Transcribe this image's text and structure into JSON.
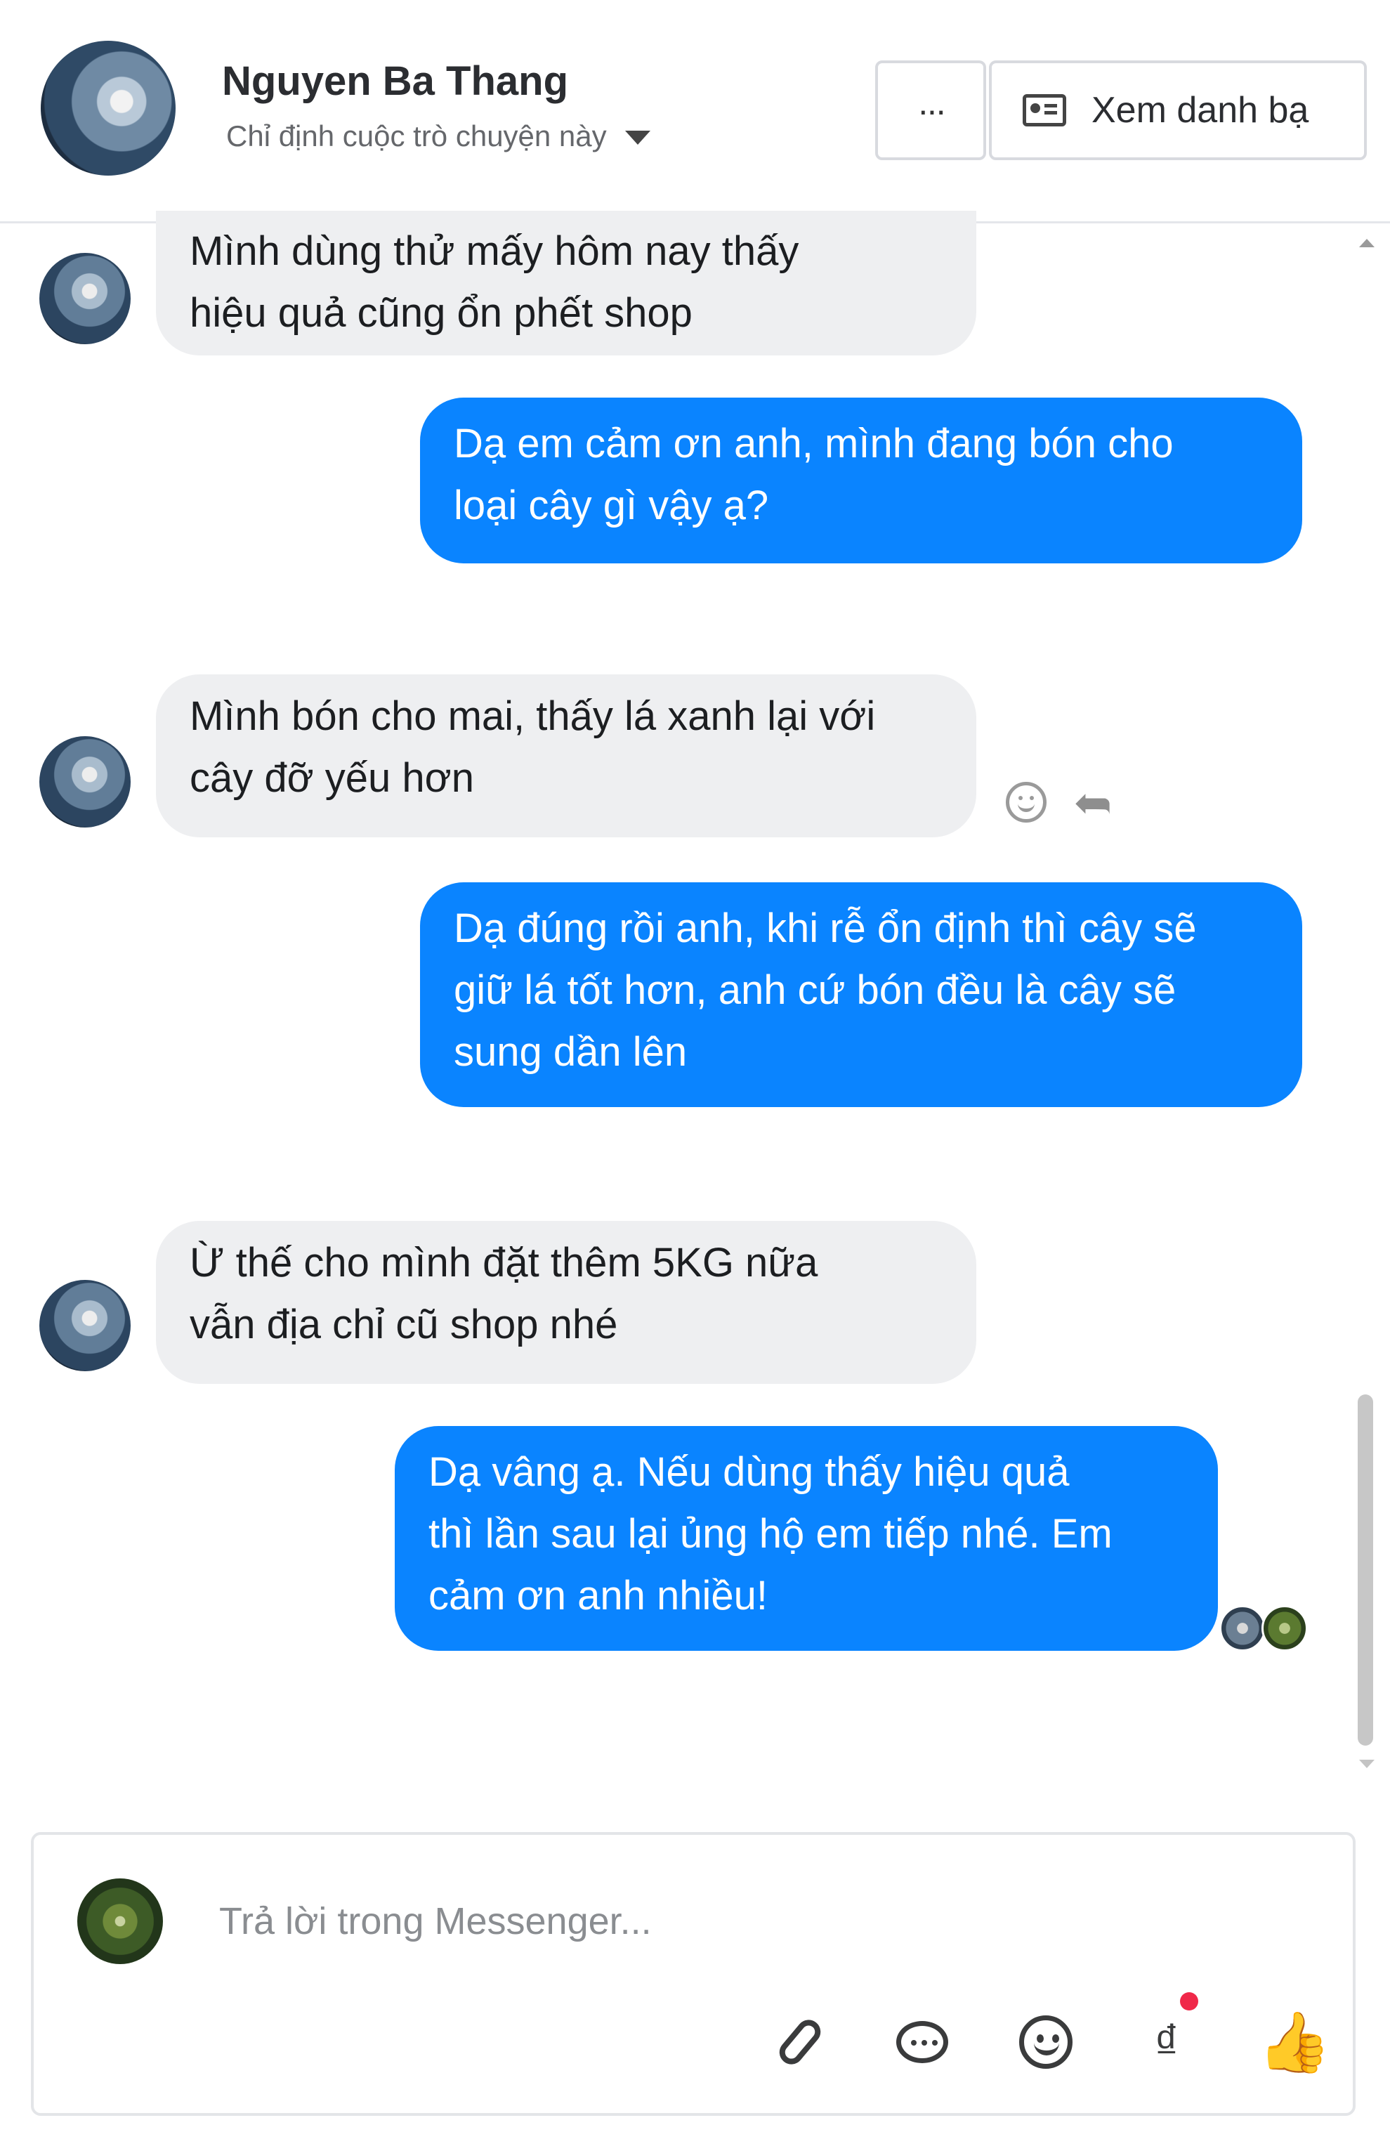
{
  "header": {
    "contact_name": "Nguyen Ba Thang",
    "assign_label": "Chỉ định cuộc trò chuyện này",
    "more_label": "···",
    "view_contacts_label": "Xem danh bạ"
  },
  "messages": [
    {
      "direction": "incoming",
      "text": "Mình dùng thử mấy hôm nay thấy\nhiệu quả cũng ổn phết shop"
    },
    {
      "direction": "outgoing",
      "text": "Dạ em cảm ơn anh, mình đang bón cho\nloại cây gì vậy ạ?"
    },
    {
      "direction": "incoming",
      "text": "Mình bón cho mai, thấy lá xanh lại với\ncây đỡ yếu hơn"
    },
    {
      "direction": "outgoing",
      "text": "Dạ đúng rồi anh, khi rễ ổn định thì cây sẽ\ngiữ lá tốt hơn, anh cứ bón đều là cây sẽ\nsung dần lên"
    },
    {
      "direction": "incoming",
      "text": "Ừ thế cho mình đặt thêm 5KG nữa\nvẫn địa chỉ cũ shop nhé"
    },
    {
      "direction": "outgoing",
      "text": "Dạ vâng ạ. Nếu dùng thấy hiệu quả\nthì lần sau lại ủng hộ em tiếp nhé. Em\ncảm ơn anh nhiều!"
    }
  ],
  "composer": {
    "placeholder": "Trả lời trong Messenger...",
    "value": "",
    "currency_symbol": "₫",
    "like_symbol": "👍"
  },
  "icons": {
    "attach": "paperclip-icon",
    "saved_replies": "chat-bubble-icon",
    "emoji": "emoji-icon",
    "payment": "dong-currency-icon",
    "like": "thumbs-up-icon",
    "react": "smiley-icon",
    "reply": "reply-arrow-icon"
  },
  "colors": {
    "outgoing_bubble": "#0a84ff",
    "incoming_bubble": "#eeeff1",
    "notification_dot": "#f02849"
  }
}
